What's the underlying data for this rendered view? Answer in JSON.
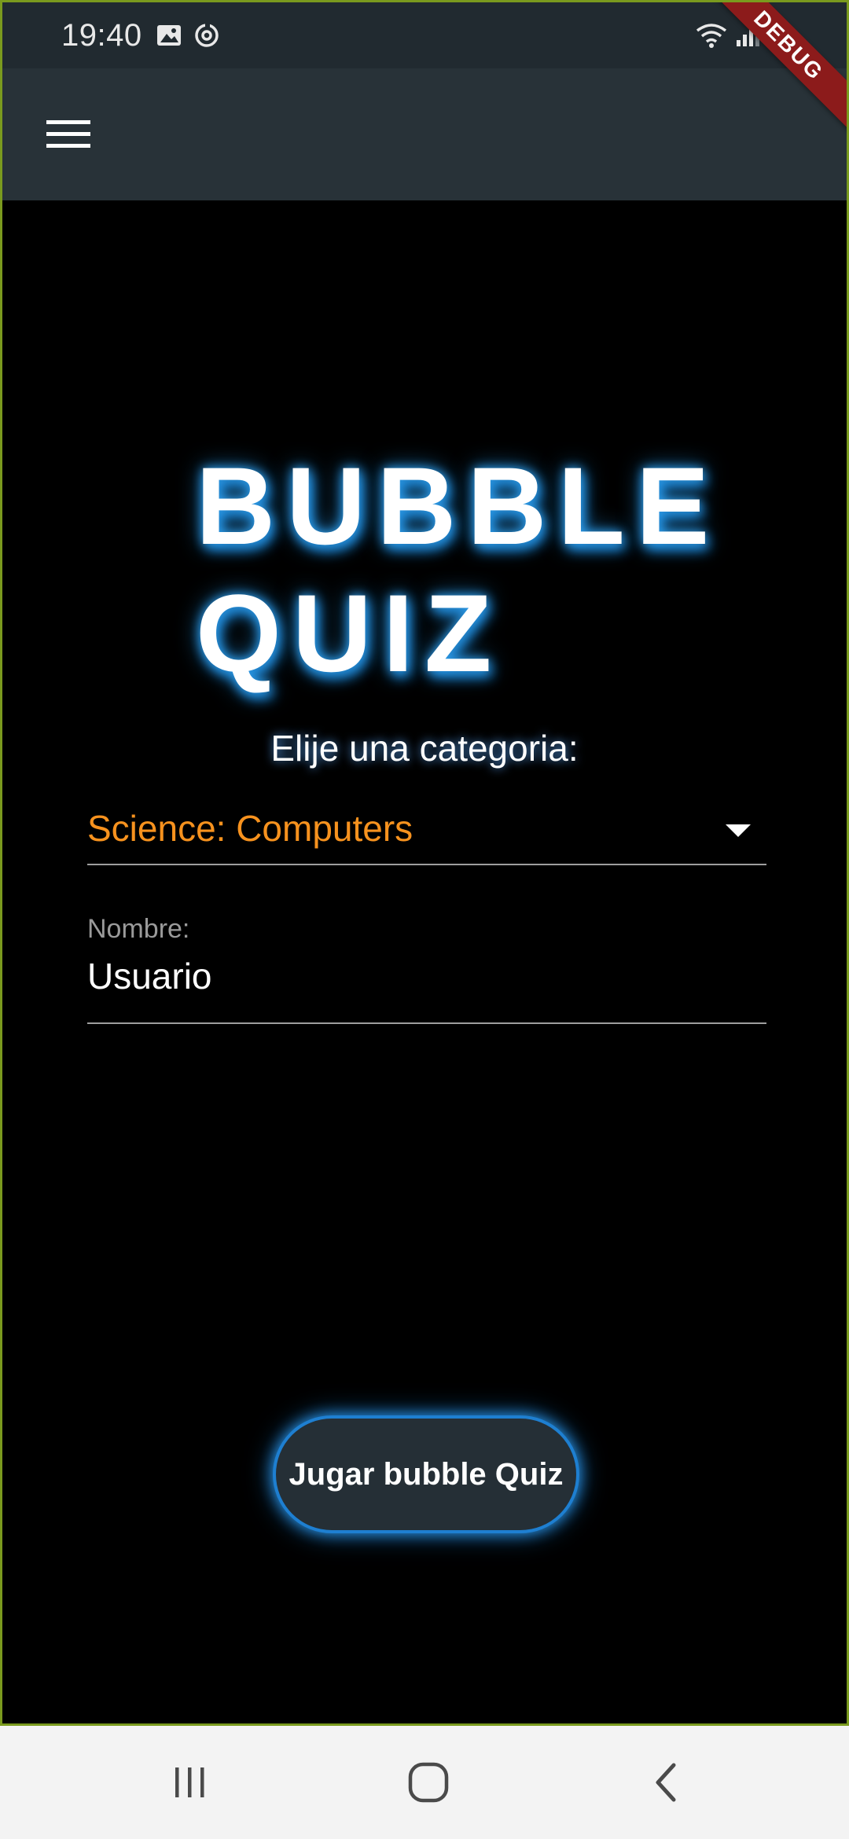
{
  "status_bar": {
    "time": "19:40",
    "icons": [
      "image-icon",
      "sync-icon",
      "wifi-icon",
      "signal-icon",
      "battery-icon"
    ]
  },
  "app_bar": {
    "menu_icon": "hamburger-menu-icon",
    "debug_banner": "DEBUG"
  },
  "title": {
    "line1": "BUBBLE",
    "line2": "QUIZ"
  },
  "category": {
    "label": "Elije una categoria:",
    "selected": "Science: Computers"
  },
  "name_field": {
    "label": "Nombre:",
    "value": "Usuario"
  },
  "play_button": {
    "label": "Jugar bubble Quiz"
  },
  "nav_bar": {
    "icons": [
      "recents-icon",
      "home-icon",
      "back-icon"
    ]
  },
  "colors": {
    "accent": "#f7921e",
    "glow": "#2c97ec",
    "app_bar": "#283238",
    "background": "#000000"
  }
}
